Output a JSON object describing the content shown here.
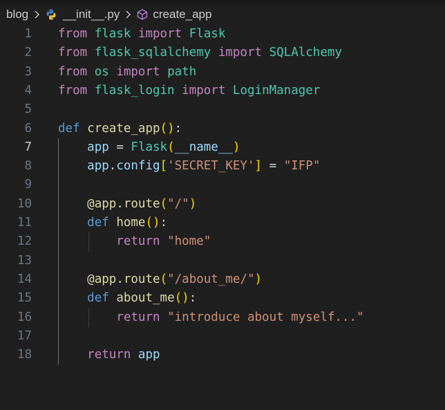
{
  "breadcrumb": {
    "folder": "blog",
    "file": "__init__.py",
    "symbol": "create_app"
  },
  "editor": {
    "active_line": 7,
    "lines": [
      {
        "num": "1",
        "tokens": [
          [
            "from",
            "ctl"
          ],
          [
            " ",
            "plain"
          ],
          [
            "flask",
            "mod"
          ],
          [
            " ",
            "plain"
          ],
          [
            "import",
            "ctl"
          ],
          [
            " ",
            "plain"
          ],
          [
            "Flask",
            "cls"
          ]
        ]
      },
      {
        "num": "2",
        "tokens": [
          [
            "from",
            "ctl"
          ],
          [
            " ",
            "plain"
          ],
          [
            "flask_sqlalchemy",
            "mod"
          ],
          [
            " ",
            "plain"
          ],
          [
            "import",
            "ctl"
          ],
          [
            " ",
            "plain"
          ],
          [
            "SQLAlchemy",
            "cls"
          ]
        ]
      },
      {
        "num": "3",
        "tokens": [
          [
            "from",
            "ctl"
          ],
          [
            " ",
            "plain"
          ],
          [
            "os",
            "mod"
          ],
          [
            " ",
            "plain"
          ],
          [
            "import",
            "ctl"
          ],
          [
            " ",
            "plain"
          ],
          [
            "path",
            "mod"
          ]
        ]
      },
      {
        "num": "4",
        "tokens": [
          [
            "from",
            "ctl"
          ],
          [
            " ",
            "plain"
          ],
          [
            "flask_login",
            "mod"
          ],
          [
            " ",
            "plain"
          ],
          [
            "import",
            "ctl"
          ],
          [
            " ",
            "plain"
          ],
          [
            "LoginManager",
            "cls"
          ]
        ]
      },
      {
        "num": "5",
        "tokens": []
      },
      {
        "num": "6",
        "tokens": [
          [
            "def",
            "kw"
          ],
          [
            " ",
            "plain"
          ],
          [
            "create_app",
            "fn"
          ],
          [
            "(",
            "p1"
          ],
          [
            ")",
            "p1"
          ],
          [
            ":",
            "plain"
          ]
        ]
      },
      {
        "num": "7",
        "tokens": [
          [
            "    ",
            "plain"
          ],
          [
            "app",
            "var"
          ],
          [
            " ",
            "plain"
          ],
          [
            "=",
            "op"
          ],
          [
            " ",
            "plain"
          ],
          [
            "Flask",
            "cls"
          ],
          [
            "(",
            "p1"
          ],
          [
            "__name__",
            "var"
          ],
          [
            ")",
            "p1"
          ]
        ]
      },
      {
        "num": "8",
        "tokens": [
          [
            "    ",
            "plain"
          ],
          [
            "app",
            "var"
          ],
          [
            ".",
            "plain"
          ],
          [
            "config",
            "var"
          ],
          [
            "[",
            "p1"
          ],
          [
            "'SECRET_KEY'",
            "str"
          ],
          [
            "]",
            "p1"
          ],
          [
            " ",
            "plain"
          ],
          [
            "=",
            "op"
          ],
          [
            " ",
            "plain"
          ],
          [
            "\"IFP\"",
            "str"
          ]
        ]
      },
      {
        "num": "9",
        "tokens": []
      },
      {
        "num": "10",
        "tokens": [
          [
            "    ",
            "plain"
          ],
          [
            "@",
            "fn"
          ],
          [
            "app",
            "fn"
          ],
          [
            ".",
            "fn"
          ],
          [
            "route",
            "fn"
          ],
          [
            "(",
            "p1"
          ],
          [
            "\"/\"",
            "str"
          ],
          [
            ")",
            "p1"
          ]
        ]
      },
      {
        "num": "11",
        "tokens": [
          [
            "    ",
            "plain"
          ],
          [
            "def",
            "kw"
          ],
          [
            " ",
            "plain"
          ],
          [
            "home",
            "fn"
          ],
          [
            "(",
            "p1"
          ],
          [
            ")",
            "p1"
          ],
          [
            ":",
            "plain"
          ]
        ]
      },
      {
        "num": "12",
        "tokens": [
          [
            "        ",
            "plain"
          ],
          [
            "return",
            "ctl"
          ],
          [
            " ",
            "plain"
          ],
          [
            "\"home\"",
            "str"
          ]
        ]
      },
      {
        "num": "13",
        "tokens": []
      },
      {
        "num": "14",
        "tokens": [
          [
            "    ",
            "plain"
          ],
          [
            "@",
            "fn"
          ],
          [
            "app",
            "fn"
          ],
          [
            ".",
            "fn"
          ],
          [
            "route",
            "fn"
          ],
          [
            "(",
            "p1"
          ],
          [
            "\"/about_me/\"",
            "str"
          ],
          [
            ")",
            "p1"
          ]
        ]
      },
      {
        "num": "15",
        "tokens": [
          [
            "    ",
            "plain"
          ],
          [
            "def",
            "kw"
          ],
          [
            " ",
            "plain"
          ],
          [
            "about_me",
            "fn"
          ],
          [
            "(",
            "p1"
          ],
          [
            ")",
            "p1"
          ],
          [
            ":",
            "plain"
          ]
        ]
      },
      {
        "num": "16",
        "tokens": [
          [
            "        ",
            "plain"
          ],
          [
            "return",
            "ctl"
          ],
          [
            " ",
            "plain"
          ],
          [
            "\"introduce about myself...\"",
            "str"
          ]
        ]
      },
      {
        "num": "17",
        "tokens": []
      },
      {
        "num": "18",
        "tokens": [
          [
            "    ",
            "plain"
          ],
          [
            "return",
            "ctl"
          ],
          [
            " ",
            "plain"
          ],
          [
            "app",
            "var"
          ]
        ]
      }
    ]
  },
  "icons": {
    "python_file": "python-icon",
    "symbol": "method-cube-icon",
    "separator": "chevron-right-icon"
  },
  "colors": {
    "background": "#1f1f1f",
    "keyword": "#569cd6",
    "control": "#c586c0",
    "type": "#4ec9b0",
    "function": "#dcdcaa",
    "variable": "#9cdcfe",
    "string": "#ce9178",
    "bracket": "#ffd700"
  }
}
